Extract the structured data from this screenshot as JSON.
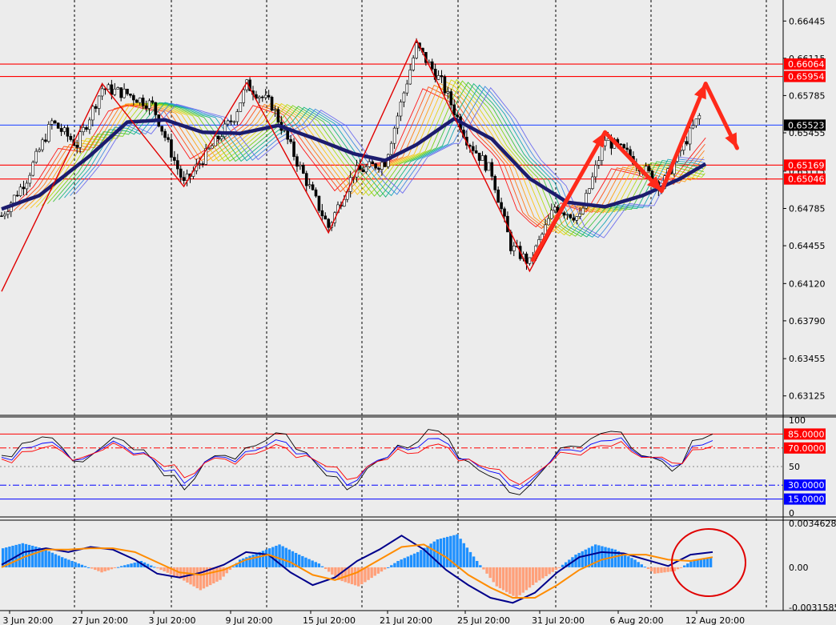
{
  "chart_data": [
    {
      "type": "line",
      "panel": "price",
      "ylim": [
        0.6296,
        0.6661
      ],
      "y_ticks": [
        "0.66445",
        "0.66115",
        "0.65785",
        "0.65455",
        "0.65115",
        "0.64785",
        "0.64455",
        "0.64120",
        "0.63790",
        "0.63455",
        "0.63125"
      ],
      "time_axis": [
        "3 Jun 20:00",
        "27 Jun 20:00",
        "3 Jul 20:00",
        "9 Jul 20:00",
        "15 Jul 20:00",
        "21 Jul 20:00",
        "25 Jul 20:00",
        "31 Jul 20:00",
        "6 Aug 20:00",
        "12 Aug 20:00"
      ],
      "horizontal_levels": [
        {
          "label": "0.66064",
          "value": 0.66064,
          "color": "#ff0000",
          "style": "solid"
        },
        {
          "label": "0.65954",
          "value": 0.65954,
          "color": "#ff0000",
          "style": "solid"
        },
        {
          "label": "0.65523",
          "value": 0.65523,
          "color": "#4060ff",
          "style": "solid"
        },
        {
          "label": "0.65169",
          "value": 0.65169,
          "color": "#ff0000",
          "style": "solid"
        },
        {
          "label": "0.65046",
          "value": 0.65046,
          "color": "#ff0000",
          "style": "solid"
        }
      ],
      "zigzag": [
        {
          "t": 0,
          "y": 0.6405
        },
        {
          "t": 16,
          "y": 0.6589
        },
        {
          "t": 29,
          "y": 0.6498
        },
        {
          "t": 39,
          "y": 0.659
        },
        {
          "t": 52,
          "y": 0.6457
        },
        {
          "t": 66,
          "y": 0.6628
        },
        {
          "t": 84,
          "y": 0.6423
        },
        {
          "t": 96,
          "y": 0.6546
        },
        {
          "t": 105,
          "y": 0.6494
        },
        {
          "t": 112,
          "y": 0.6589
        }
      ],
      "projection": [
        {
          "t": 112,
          "y": 0.6589
        },
        {
          "t": 115,
          "y": 0.6532
        }
      ],
      "price_path": [
        {
          "t": 0,
          "y": 0.6472
        },
        {
          "t": 4,
          "y": 0.6505
        },
        {
          "t": 8,
          "y": 0.6555
        },
        {
          "t": 12,
          "y": 0.6535
        },
        {
          "t": 16,
          "y": 0.6585
        },
        {
          "t": 20,
          "y": 0.658
        },
        {
          "t": 24,
          "y": 0.657
        },
        {
          "t": 29,
          "y": 0.65
        },
        {
          "t": 33,
          "y": 0.653
        },
        {
          "t": 37,
          "y": 0.656
        },
        {
          "t": 39,
          "y": 0.6588
        },
        {
          "t": 43,
          "y": 0.657
        },
        {
          "t": 47,
          "y": 0.652
        },
        {
          "t": 52,
          "y": 0.6462
        },
        {
          "t": 56,
          "y": 0.651
        },
        {
          "t": 61,
          "y": 0.652
        },
        {
          "t": 66,
          "y": 0.6622
        },
        {
          "t": 70,
          "y": 0.659
        },
        {
          "t": 74,
          "y": 0.654
        },
        {
          "t": 78,
          "y": 0.651
        },
        {
          "t": 81,
          "y": 0.6445
        },
        {
          "t": 84,
          "y": 0.643
        },
        {
          "t": 88,
          "y": 0.648
        },
        {
          "t": 92,
          "y": 0.647
        },
        {
          "t": 96,
          "y": 0.654
        },
        {
          "t": 100,
          "y": 0.6525
        },
        {
          "t": 105,
          "y": 0.6498
        },
        {
          "t": 108,
          "y": 0.653
        },
        {
          "t": 111,
          "y": 0.656
        }
      ],
      "slow_ma": [
        {
          "t": 0,
          "y": 0.6478
        },
        {
          "t": 6,
          "y": 0.649
        },
        {
          "t": 14,
          "y": 0.6525
        },
        {
          "t": 20,
          "y": 0.6555
        },
        {
          "t": 26,
          "y": 0.6557
        },
        {
          "t": 32,
          "y": 0.6546
        },
        {
          "t": 38,
          "y": 0.6545
        },
        {
          "t": 44,
          "y": 0.6552
        },
        {
          "t": 50,
          "y": 0.654
        },
        {
          "t": 56,
          "y": 0.6527
        },
        {
          "t": 61,
          "y": 0.6521
        },
        {
          "t": 66,
          "y": 0.6535
        },
        {
          "t": 72,
          "y": 0.6558
        },
        {
          "t": 78,
          "y": 0.654
        },
        {
          "t": 84,
          "y": 0.6505
        },
        {
          "t": 90,
          "y": 0.6484
        },
        {
          "t": 96,
          "y": 0.648
        },
        {
          "t": 102,
          "y": 0.649
        },
        {
          "t": 108,
          "y": 0.6505
        },
        {
          "t": 112,
          "y": 0.6518
        }
      ]
    },
    {
      "type": "line",
      "panel": "oscillator",
      "ylim": [
        0,
        100
      ],
      "y_ticks": [
        "100",
        "50",
        "0"
      ],
      "levels": [
        {
          "label": "85.0000",
          "value": 85,
          "color": "#ff0000",
          "style": "solid"
        },
        {
          "label": "70.0000",
          "value": 70,
          "color": "#ff0000",
          "style": "dashdot"
        },
        {
          "label": "50",
          "value": 50,
          "color": "#888888",
          "style": "dotted"
        },
        {
          "label": "30.0000",
          "value": 30,
          "color": "#0000ff",
          "style": "dashdot"
        },
        {
          "label": "15.0000",
          "value": 15,
          "color": "#0000ff",
          "style": "solid"
        }
      ],
      "series": [
        {
          "color": "#000000",
          "values": [
            62,
            75,
            82,
            70,
            55,
            72,
            78,
            68,
            40,
            25,
            55,
            62,
            70,
            78,
            85,
            65,
            40,
            25,
            48,
            60,
            70,
            90,
            80,
            55,
            40,
            22,
            30,
            55,
            72,
            80,
            88,
            70,
            60,
            45,
            78,
            85
          ]
        },
        {
          "color": "#0000ff",
          "values": [
            60,
            70,
            75,
            68,
            58,
            70,
            72,
            65,
            45,
            32,
            55,
            60,
            66,
            72,
            76,
            64,
            45,
            30,
            50,
            60,
            68,
            80,
            74,
            58,
            45,
            30,
            34,
            55,
            68,
            74,
            78,
            68,
            60,
            50,
            72,
            78
          ]
        },
        {
          "color": "#ff0000",
          "values": [
            58,
            66,
            70,
            66,
            60,
            68,
            70,
            64,
            50,
            38,
            54,
            58,
            63,
            68,
            70,
            62,
            50,
            36,
            50,
            58,
            64,
            72,
            70,
            58,
            48,
            36,
            38,
            54,
            64,
            70,
            72,
            66,
            60,
            54,
            68,
            72
          ]
        }
      ]
    },
    {
      "type": "bar",
      "panel": "macd",
      "ylim": [
        -0.0031585,
        0.0034628
      ],
      "y_ticks": [
        "0.0034628",
        "0.00",
        "-0.0031585"
      ],
      "histogram": [
        0.0015,
        0.0019,
        0.0015,
        0.0008,
        0.0002,
        -0.0004,
        0.0001,
        0.0005,
        -0.0002,
        -0.0009,
        -0.0018,
        -0.001,
        0.0006,
        0.0012,
        0.0018,
        0.001,
        0.0003,
        -0.001,
        -0.0015,
        -0.0005,
        0.0005,
        0.0012,
        0.0022,
        0.0026,
        0.0005,
        -0.0015,
        -0.0024,
        -0.0012,
        -0.0002,
        0.001,
        0.0018,
        0.0014,
        0.0006,
        -0.0005,
        -0.0003,
        0.0006,
        0.0008
      ],
      "series": [
        {
          "color": "#00008b",
          "values": [
            0.0002,
            0.0012,
            0.0015,
            0.0012,
            0.0016,
            0.0014,
            0.0006,
            -0.0005,
            -0.0008,
            -0.0004,
            0.0002,
            0.0012,
            0.001,
            -0.0004,
            -0.0014,
            -0.0008,
            0.0005,
            0.0014,
            0.0025,
            0.0014,
            -0.0002,
            -0.0014,
            -0.0024,
            -0.0028,
            -0.002,
            -0.0004,
            0.0008,
            0.0012,
            0.0011,
            0.0006,
            0.0001,
            0.001,
            0.0012
          ]
        },
        {
          "color": "#ff8c00",
          "values": [
            0.0,
            0.0008,
            0.0014,
            0.0014,
            0.0015,
            0.0015,
            0.0012,
            0.0004,
            -0.0004,
            -0.0006,
            -0.0002,
            0.0006,
            0.001,
            0.0004,
            -0.0006,
            -0.001,
            -0.0004,
            0.0006,
            0.0016,
            0.0018,
            0.0008,
            -0.0006,
            -0.0016,
            -0.0024,
            -0.0024,
            -0.0014,
            -0.0002,
            0.0006,
            0.001,
            0.001,
            0.0006,
            0.0005,
            0.0008
          ]
        }
      ]
    }
  ]
}
